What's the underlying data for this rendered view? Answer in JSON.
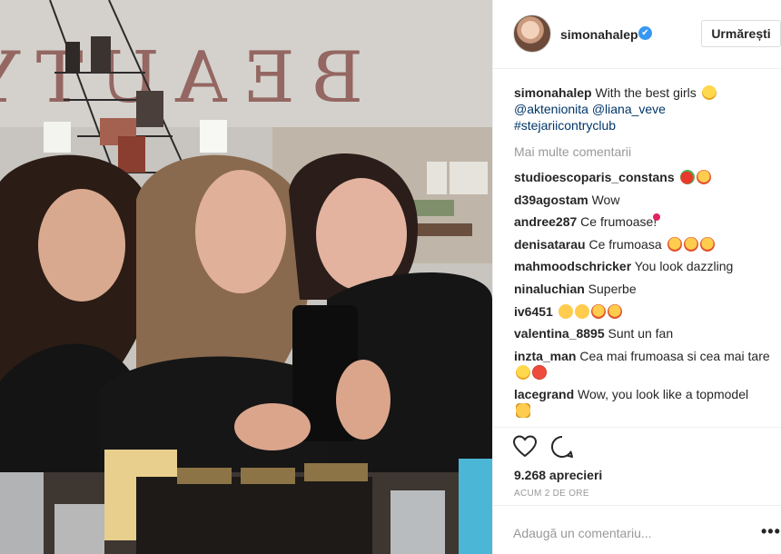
{
  "post": {
    "username": "simonahalep",
    "verified_mark": "✔",
    "follow_label": "Urmărești",
    "caption": {
      "user": "simonahalep",
      "text": " With the best girls ",
      "emoji": "hugging-face-emoji",
      "mentions": "@aktenionita @liana_veve",
      "hashtag": "#stejariicontryclub"
    },
    "more_comments": "Mai multe comentarii",
    "comments": [
      {
        "user": "studioescoparis_constans",
        "text": " ",
        "emojis": [
          "pepper-emoji",
          "heart-eyes-emoji"
        ]
      },
      {
        "user": "d39agostam",
        "text": " Wow"
      },
      {
        "user": "andree287",
        "text": " Ce frumoase!",
        "emojis": [
          "heart-emoji"
        ]
      },
      {
        "user": "denisatarau",
        "text": " Ce frumoasa ",
        "emojis": [
          "heart-eyes-emoji",
          "heart-eyes-emoji",
          "heart-eyes-emoji"
        ]
      },
      {
        "user": "mahmoodschricker",
        "text": " You look dazzling"
      },
      {
        "user": "ninaluchian",
        "text": " Superbe"
      },
      {
        "user": "iv6451",
        "text": " ",
        "emojis": [
          "clap-emoji",
          "ok-hand-emoji",
          "heart-eyes-emoji",
          "heart-eyes-emoji"
        ]
      },
      {
        "user": "valentina_8895",
        "text": " Sunt un fan"
      },
      {
        "user": "inzta_man",
        "text": " Cea mai frumoasa si cea mai tare",
        "emojis": [
          "hugging-face-emoji",
          "ping-pong-emoji"
        ]
      },
      {
        "user": "lacegrand",
        "text": " Wow, you look like a topmodel",
        "emojis": [
          "thumbs-up-emoji"
        ]
      }
    ],
    "likes": "9.268 aprecieri",
    "time": "ACUM 2 DE ORE",
    "add_comment_placeholder": "Adaugă un comentariu...",
    "more_options": "•••",
    "photo_sign_text": "BEAUTY LOUNGE"
  }
}
